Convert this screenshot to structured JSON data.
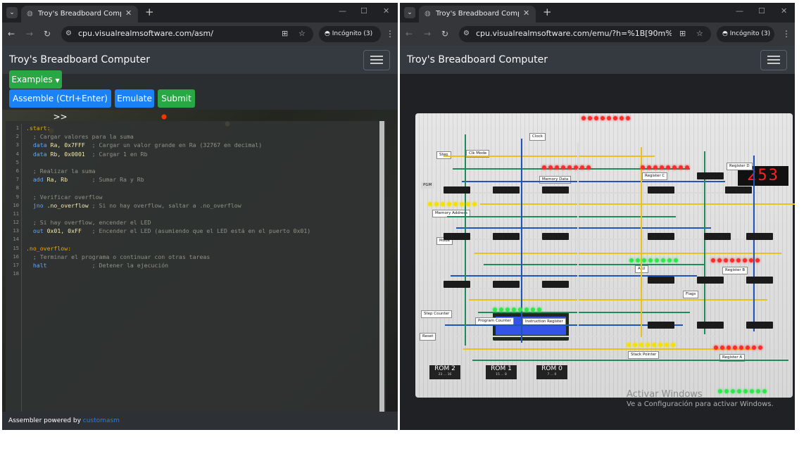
{
  "left_window": {
    "tab_title": "Troy's Breadboard Computer - ",
    "url": "cpu.visualrealmsoftware.com/asm/",
    "incognito_label": "Incógnito (3)",
    "navbar_title": "Troy's Breadboard Computer",
    "examples_label": "Examples",
    "assemble_label": "Assemble (Ctrl+Enter) >>",
    "emulate_label": "Emulate",
    "submit_label": "Submit",
    "footer_text": "Assembler powered by ",
    "footer_link": "customasm",
    "code_lines": [
      {
        "n": "1",
        "tokens": [
          {
            "t": ".start:",
            "c": "label"
          }
        ]
      },
      {
        "n": "2",
        "tokens": [
          {
            "t": "  ; Cargar valores para la suma",
            "c": "comment"
          }
        ]
      },
      {
        "n": "3",
        "tokens": [
          {
            "t": "  data ",
            "c": "instr"
          },
          {
            "t": "Ra, 0x7FFF",
            "c": "arg"
          },
          {
            "t": "  ; Cargar un valor grande en Ra (32767 en decimal)",
            "c": "comment"
          }
        ]
      },
      {
        "n": "4",
        "tokens": [
          {
            "t": "  data ",
            "c": "instr"
          },
          {
            "t": "Rb, 0x0001",
            "c": "arg"
          },
          {
            "t": "  ; Cargar 1 en Rb",
            "c": "comment"
          }
        ]
      },
      {
        "n": "5",
        "tokens": []
      },
      {
        "n": "6",
        "tokens": [
          {
            "t": "  ; Realizar la suma",
            "c": "comment"
          }
        ]
      },
      {
        "n": "7",
        "tokens": [
          {
            "t": "  add ",
            "c": "instr"
          },
          {
            "t": "Ra, Rb",
            "c": "arg"
          },
          {
            "t": "       ; Sumar Ra y Rb",
            "c": "comment"
          }
        ]
      },
      {
        "n": "8",
        "tokens": []
      },
      {
        "n": "9",
        "tokens": [
          {
            "t": "  ; Verificar overflow",
            "c": "comment"
          }
        ]
      },
      {
        "n": "10",
        "tokens": [
          {
            "t": "  jno ",
            "c": "instr"
          },
          {
            "t": ".no_overflow",
            "c": "arg"
          },
          {
            "t": " ; Si no hay overflow, saltar a .no_overflow",
            "c": "comment"
          }
        ]
      },
      {
        "n": "11",
        "tokens": []
      },
      {
        "n": "12",
        "tokens": [
          {
            "t": "  ; Si hay overflow, encender el LED",
            "c": "comment"
          }
        ]
      },
      {
        "n": "13",
        "tokens": [
          {
            "t": "  out ",
            "c": "instr"
          },
          {
            "t": "0x01, 0xFF",
            "c": "arg"
          },
          {
            "t": "   ; Encender el LED (asumiendo que el LED está en el puerto 0x01)",
            "c": "comment"
          }
        ]
      },
      {
        "n": "14",
        "tokens": []
      },
      {
        "n": "15",
        "tokens": [
          {
            "t": ".no_overflow:",
            "c": "label"
          }
        ]
      },
      {
        "n": "16",
        "tokens": [
          {
            "t": "  ; Terminar el programa o continuar con otras tareas",
            "c": "comment"
          }
        ]
      },
      {
        "n": "17",
        "tokens": [
          {
            "t": "  halt",
            "c": "instr"
          },
          {
            "t": "             ; Detener la ejecución",
            "c": "comment"
          }
        ]
      },
      {
        "n": "18",
        "tokens": []
      }
    ]
  },
  "right_window": {
    "tab_title": "Troy's Breadboard Computer - ",
    "url": "cpu.visualrealmsoftware.com/emu/?h=%1B[90m%1B[1m%1B[...",
    "incognito_label": "Incógnito (3)",
    "navbar_title": "Troy's Breadboard Computer",
    "display_value": "253",
    "labels": {
      "clock": "Clock",
      "step": "Step",
      "clk_mode": "Clk Mode",
      "memory_data": "Memory Data",
      "register_c": "Register C",
      "register_d": "Register D",
      "pgm": "PGM",
      "memory_address": "Memory Address",
      "mode": "Mode",
      "alu": "ALU",
      "register_b": "Register B",
      "flags": "Flags",
      "step_counter": "Step Counter",
      "program_counter": "Program Counter",
      "instruction_register": "Instruction Register",
      "reset": "Reset",
      "stack_pointer": "Stack Pointer",
      "register_a": "Register A"
    },
    "roms": [
      {
        "name": "ROM 2",
        "range": "23 ... 16"
      },
      {
        "name": "ROM 1",
        "range": "15 ... 8"
      },
      {
        "name": "ROM 0",
        "range": "7 ... 0"
      }
    ],
    "watermark_title": "Activar Windows",
    "watermark_text": "Ve a Configuración para activar Windows."
  },
  "colors": {
    "browser_bg": "#202124",
    "navbar": "#343a40",
    "green_button": "#28a745",
    "blue_button": "#1a82f5"
  }
}
